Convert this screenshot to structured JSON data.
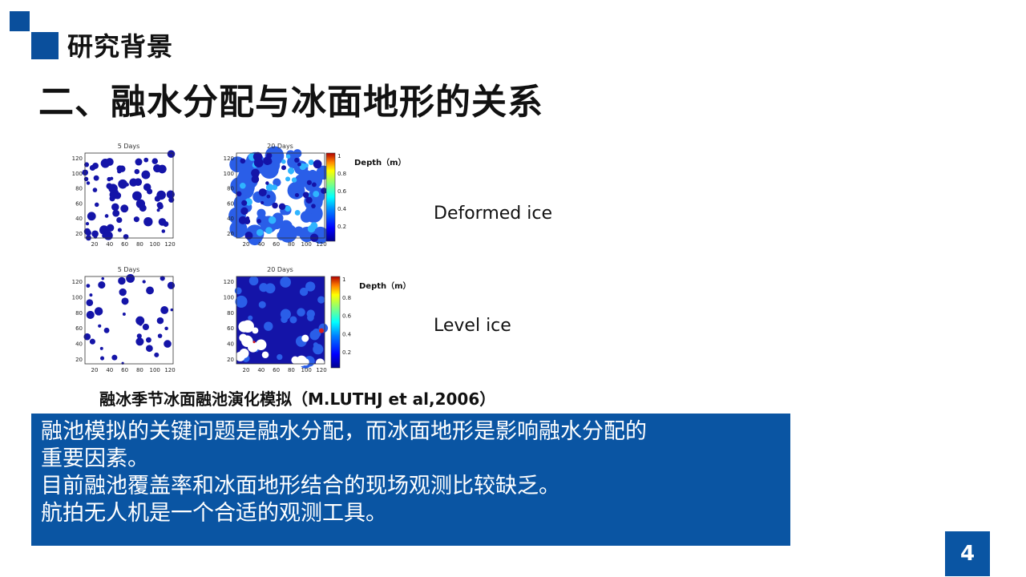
{
  "section_title": "研究背景",
  "main_title": "二、融水分配与冰面地形的关系",
  "figure": {
    "panel_titles": {
      "days5": "5 Days",
      "days20": "20 Days"
    },
    "x_ticks": [
      "20",
      "40",
      "60",
      "80",
      "100",
      "120"
    ],
    "y_ticks": [
      "120",
      "100",
      "80",
      "60",
      "40",
      "20"
    ],
    "colorbar_ticks": [
      "1",
      "0.8",
      "0.6",
      "0.4",
      "0.2"
    ],
    "colorbar_label": "Depth（m）",
    "rows": [
      {
        "label": "Deformed ice"
      },
      {
        "label": "Level ice"
      }
    ],
    "colors": {
      "pond": "#1414a8",
      "shallow": "#2a5ee8",
      "mid": "#2fb4ff",
      "deep": "#d81b1b"
    }
  },
  "caption": "融冰季节冰面融池演化模拟（M.LUTHJ et al,2006）",
  "info_lines": [
    "融池模拟的关键问题是融水分配，而冰面地形是影响融水分配的",
    "重要因素。",
    "目前融池覆盖率和冰面地形结合的现场观测比较缺乏。",
    "航拍无人机是一个合适的观测工具。"
  ],
  "page_number": "4"
}
